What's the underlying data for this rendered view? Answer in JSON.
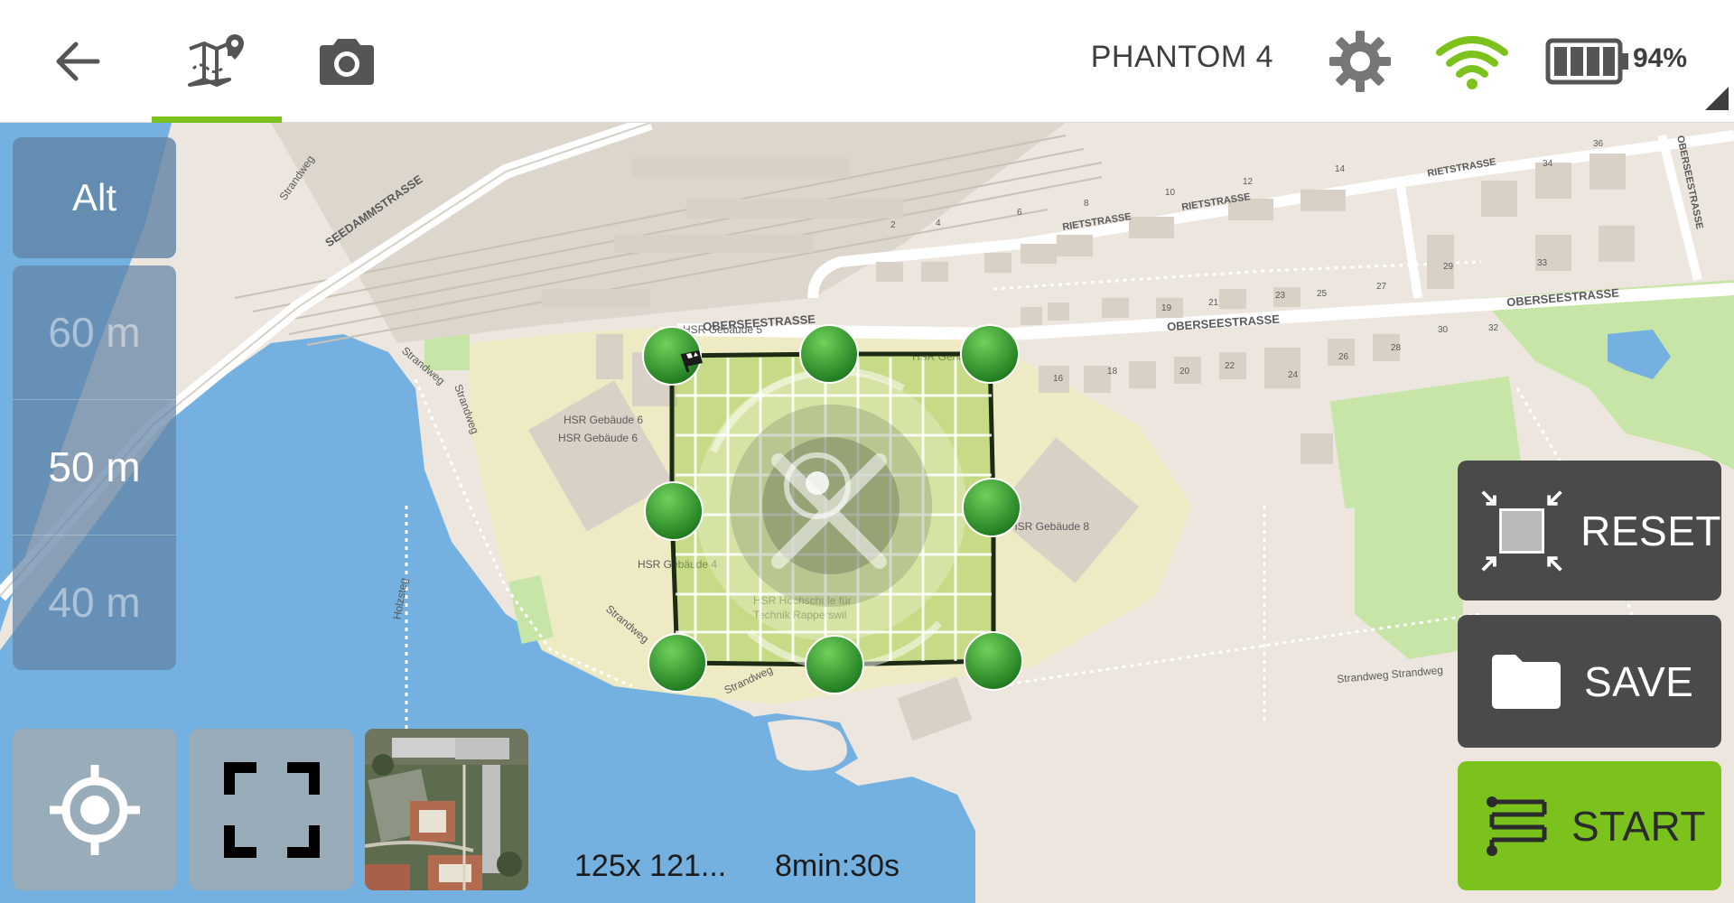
{
  "header": {
    "back_icon": "arrow-left-icon",
    "tabs": [
      {
        "icon": "map-pin-icon",
        "active": true
      },
      {
        "icon": "camera-icon",
        "active": false
      }
    ],
    "drone_name": "PHANTOM 4",
    "settings_icon": "gear-icon",
    "wifi_icon": "wifi-icon",
    "battery_icon": "battery-icon",
    "battery_percent": "94%"
  },
  "altitude": {
    "heading": "Alt",
    "options": [
      "60 m",
      "50 m",
      "40 m"
    ],
    "selected": "50 m"
  },
  "map": {
    "streets": [
      "SEEDAMMSTRASSE",
      "OBERSEESTRASSE",
      "OBERSEESTRASSE",
      "OBERSEESTRASSE",
      "RIETSTRASSE",
      "RIETSTRASSE",
      "RIETSTRASSE",
      "OBERSEESTRASSE",
      "Strandweg",
      "Strandweg",
      "Strandweg",
      "Strandweg",
      "Strandweg",
      "Strandweg Strandweg",
      "Holzsteg"
    ],
    "buildings": [
      "HSR Gebäude 6",
      "HSR Gebäude 6",
      "HSR Gebäude 5",
      "HSR Gebäude 2",
      "HSR Gebäude 8",
      "HSR Gebäude 4",
      "HSR Hochschule für",
      "Technik Rapperswil"
    ],
    "house_numbers": [
      "2",
      "4",
      "6",
      "8",
      "10",
      "12",
      "14",
      "16",
      "18",
      "19",
      "20",
      "21",
      "22",
      "23",
      "24",
      "25",
      "26",
      "27",
      "28",
      "29",
      "30",
      "32",
      "33",
      "34",
      "36"
    ]
  },
  "bottom_left": {
    "locate_icon": "crosshair-icon",
    "fullscreen_icon": "fullscreen-icon",
    "satellite_thumbnail": "satellite-thumbnail"
  },
  "stats": {
    "area": "125x 121...",
    "duration": "8min:30s"
  },
  "actions": {
    "reset": {
      "label": "RESET",
      "icon": "shrink-icon"
    },
    "save": {
      "label": "SAVE",
      "icon": "folder-icon"
    },
    "start": {
      "label": "START",
      "icon": "flight-path-icon"
    }
  },
  "colors": {
    "accent": "#7cc21c",
    "water": "#74b1e0",
    "land": "#ece6df",
    "campus": "#eeebc4",
    "park": "#c8e5a8",
    "handle": "#2e9b2e"
  }
}
